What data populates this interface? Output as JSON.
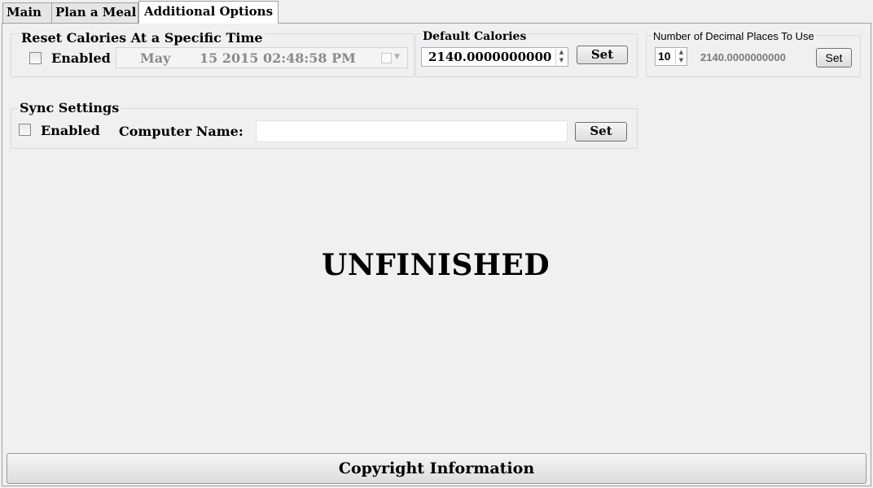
{
  "tabs": {
    "main": "Main",
    "plan": "Plan a Meal",
    "additional": "Additional Options"
  },
  "reset": {
    "title": "Reset Calories At a Specific Time",
    "enabled_label": "Enabled",
    "month": "May",
    "datetime": "15 2015 02:48:58 PM"
  },
  "default_calories": {
    "title": "Default Calories",
    "value": "2140.0000000000",
    "set_label": "Set"
  },
  "decimals": {
    "title": "Number of Decimal Places To Use",
    "value": "10",
    "preview": "2140.0000000000",
    "set_label": "Set"
  },
  "sync": {
    "title": "Sync Settings",
    "enabled_label": "Enabled",
    "computer_name_label": "Computer Name:",
    "computer_name_value": "",
    "set_label": "Set"
  },
  "main_text": "UNFINISHED",
  "footer": {
    "copyright_label": "Copyright Information"
  }
}
